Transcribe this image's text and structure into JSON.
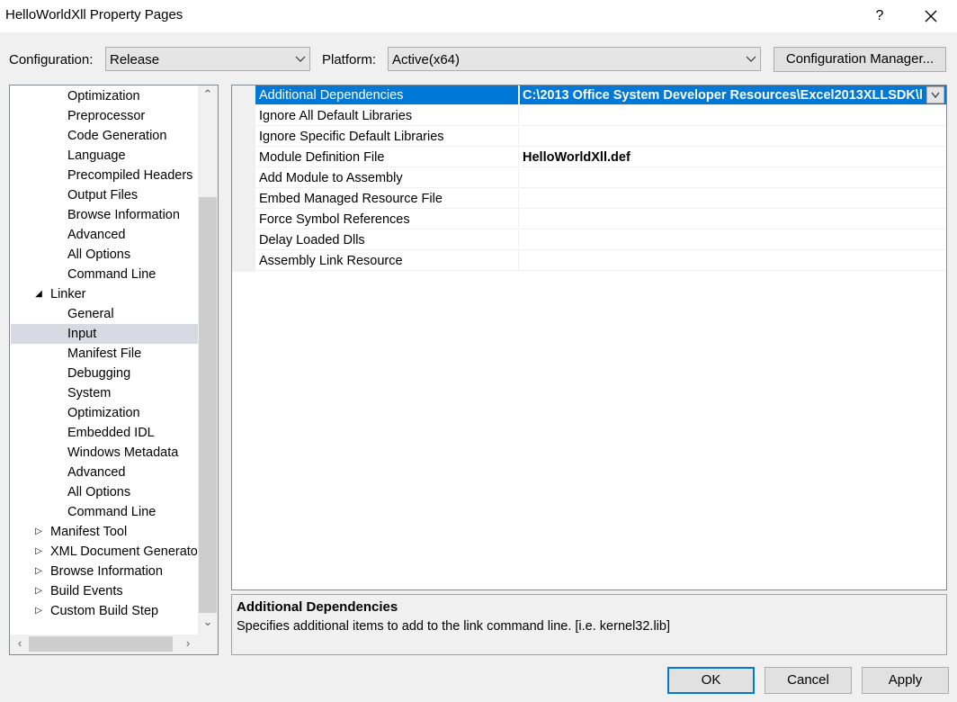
{
  "window": {
    "title": "HelloWorldXll Property Pages",
    "help": "?",
    "close_icon": "close-icon"
  },
  "toolbar": {
    "configuration_label": "Configuration:",
    "configuration_value": "Release",
    "platform_label": "Platform:",
    "platform_value": "Active(x64)",
    "config_manager_label": "Configuration Manager..."
  },
  "tree": {
    "items": [
      {
        "label": "Optimization",
        "level": 2
      },
      {
        "label": "Preprocessor",
        "level": 2
      },
      {
        "label": "Code Generation",
        "level": 2
      },
      {
        "label": "Language",
        "level": 2
      },
      {
        "label": "Precompiled Headers",
        "level": 2
      },
      {
        "label": "Output Files",
        "level": 2
      },
      {
        "label": "Browse Information",
        "level": 2
      },
      {
        "label": "Advanced",
        "level": 2
      },
      {
        "label": "All Options",
        "level": 2
      },
      {
        "label": "Command Line",
        "level": 2
      },
      {
        "label": "Linker",
        "level": 1,
        "expander": "expanded"
      },
      {
        "label": "General",
        "level": 2
      },
      {
        "label": "Input",
        "level": 2,
        "selected": true
      },
      {
        "label": "Manifest File",
        "level": 2
      },
      {
        "label": "Debugging",
        "level": 2
      },
      {
        "label": "System",
        "level": 2
      },
      {
        "label": "Optimization",
        "level": 2
      },
      {
        "label": "Embedded IDL",
        "level": 2
      },
      {
        "label": "Windows Metadata",
        "level": 2
      },
      {
        "label": "Advanced",
        "level": 2
      },
      {
        "label": "All Options",
        "level": 2
      },
      {
        "label": "Command Line",
        "level": 2
      },
      {
        "label": "Manifest Tool",
        "level": 1,
        "expander": "collapsed"
      },
      {
        "label": "XML Document Generato",
        "level": 1,
        "expander": "collapsed"
      },
      {
        "label": "Browse Information",
        "level": 1,
        "expander": "collapsed"
      },
      {
        "label": "Build Events",
        "level": 1,
        "expander": "collapsed"
      },
      {
        "label": "Custom Build Step",
        "level": 1,
        "expander": "collapsed"
      }
    ]
  },
  "properties": {
    "rows": [
      {
        "name": "Additional Dependencies",
        "value": "C:\\2013 Office System Developer Resources\\Excel2013XLLSDK\\l",
        "selected": true
      },
      {
        "name": "Ignore All Default Libraries",
        "value": ""
      },
      {
        "name": "Ignore Specific Default Libraries",
        "value": ""
      },
      {
        "name": "Module Definition File",
        "value": "HelloWorldXll.def"
      },
      {
        "name": "Add Module to Assembly",
        "value": ""
      },
      {
        "name": "Embed Managed Resource File",
        "value": ""
      },
      {
        "name": "Force Symbol References",
        "value": ""
      },
      {
        "name": "Delay Loaded Dlls",
        "value": ""
      },
      {
        "name": "Assembly Link Resource",
        "value": ""
      }
    ]
  },
  "description": {
    "title": "Additional Dependencies",
    "text": "Specifies additional items to add to the link command line. [i.e. kernel32.lib]"
  },
  "buttons": {
    "ok": "OK",
    "cancel": "Cancel",
    "apply": "Apply"
  },
  "colors": {
    "accent": "#0078d7",
    "tree_selection": "#d9d9e3"
  }
}
